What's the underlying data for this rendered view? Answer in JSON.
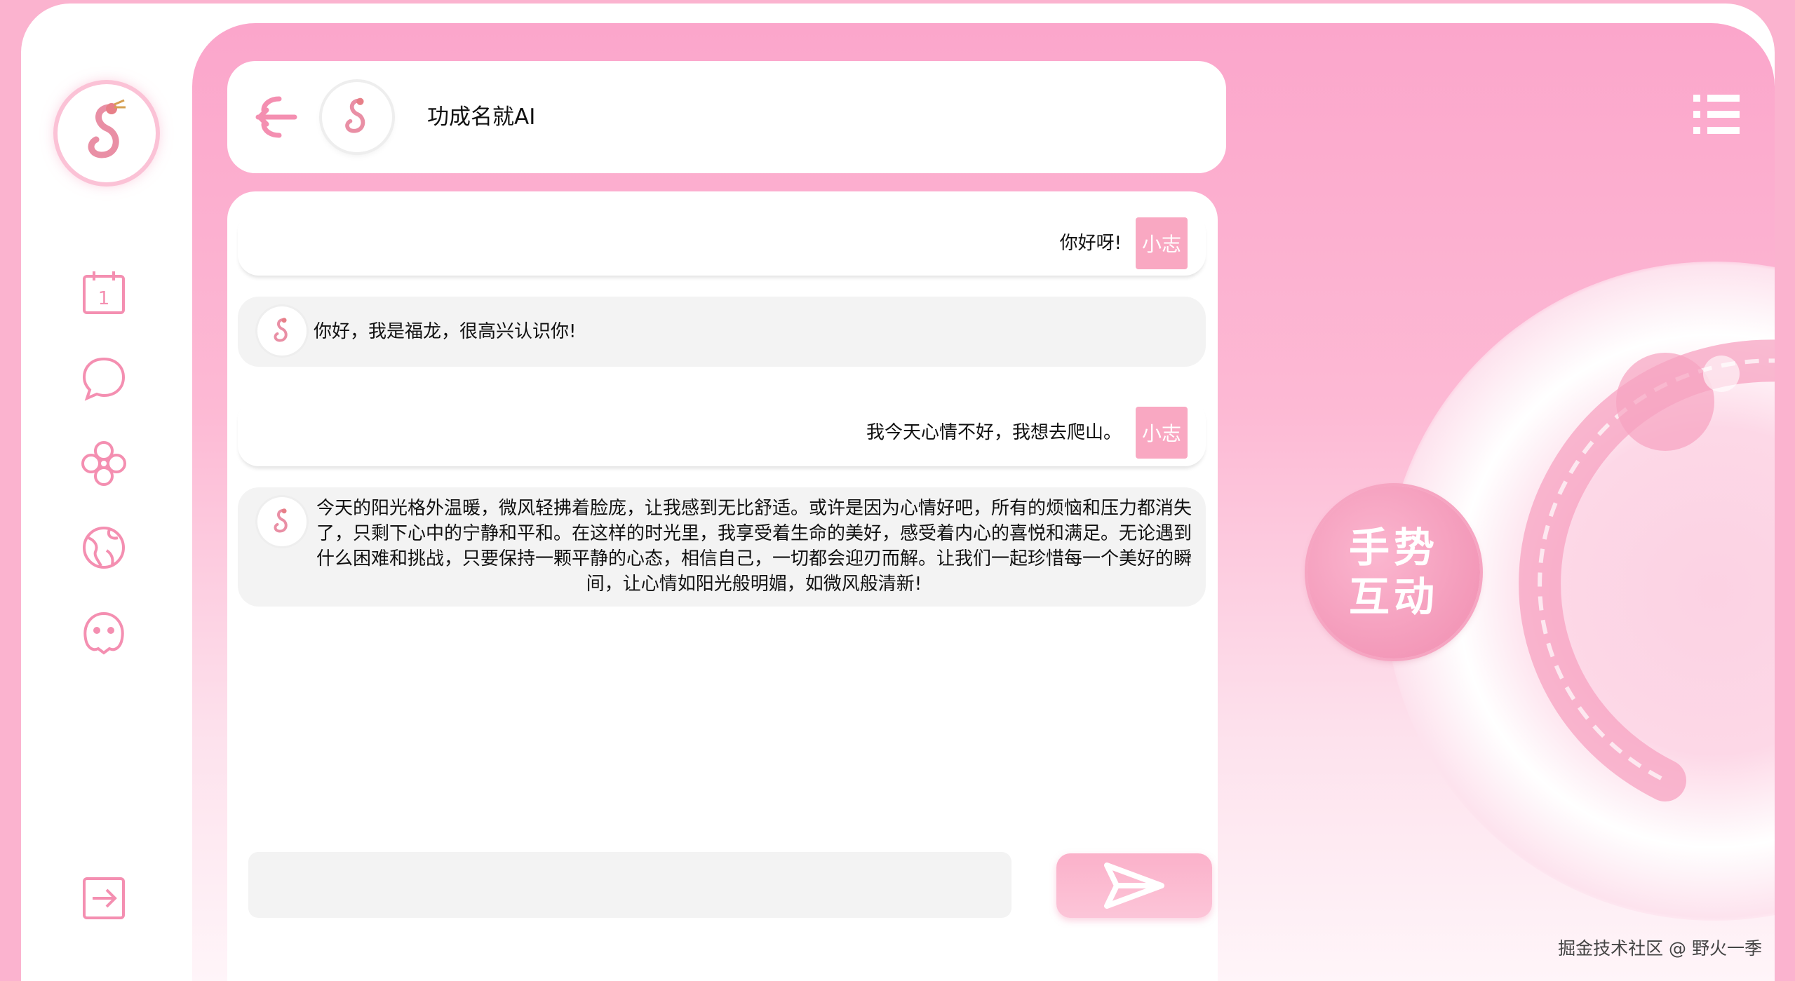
{
  "header": {
    "title": "功成名就AI"
  },
  "messages": [
    {
      "role": "user",
      "text": "你好呀!",
      "badge": "小志"
    },
    {
      "role": "bot",
      "text": "你好，我是福龙，很高兴认识你!"
    },
    {
      "role": "user",
      "text": "我今天心情不好，我想去爬山。",
      "badge": "小志"
    },
    {
      "role": "bot",
      "text": "今天的阳光格外温暖，微风轻拂着脸庞，让我感到无比舒适。或许是因为心情好吧，所有的烦恼和压力都消失了，只剩下心中的宁静和平和。在这样的时光里，我享受着生命的美好，感受着内心的喜悦和满足。无论遇到什么困难和挑战，只要保持一颗平静的心态，相信自己，一切都会迎刃而解。让我们一起珍惜每一个美好的瞬间，让心情如阳光般明媚，如微风般清新!"
    }
  ],
  "input": {
    "value": "",
    "placeholder": ""
  },
  "gesture": {
    "line1": "手势",
    "line2": "互动"
  },
  "nav": [
    "calendar-icon",
    "chat-icon",
    "flower-icon",
    "globe-icon",
    "pet-icon",
    "logout-icon"
  ],
  "colors": {
    "accent": "#f48fb1",
    "bg": "#fbb3cf"
  },
  "watermark": "掘金技术社区 @ 野火一季"
}
